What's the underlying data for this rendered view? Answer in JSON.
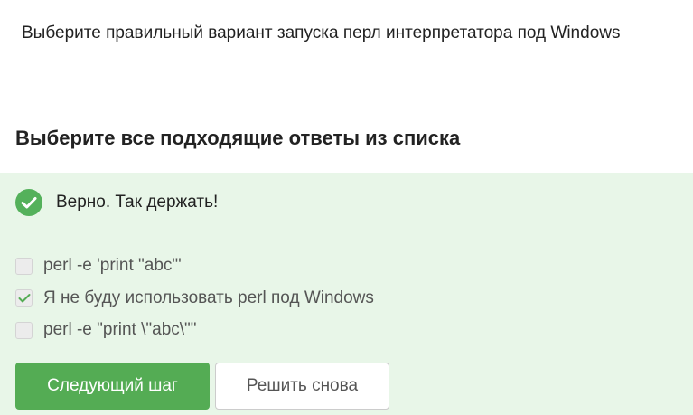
{
  "question": {
    "text": "Выберите правильный вариант запуска перл интерпретатора под Windows"
  },
  "section": {
    "title": "Выберите все подходящие ответы из списка"
  },
  "feedback": {
    "icon": "check-circle-icon",
    "text": "Верно. Так держать!",
    "color": "#54b15b"
  },
  "options": [
    {
      "label": "perl -e 'print \"abc\"'",
      "checked": false
    },
    {
      "label": "Я не буду использовать perl под Windows",
      "checked": true
    },
    {
      "label": "perl -e \"print \\\"abc\\\"\"",
      "checked": false
    }
  ],
  "buttons": {
    "next_label": "Следующий шаг",
    "retry_label": "Решить снова",
    "next_color": "#54ac54"
  }
}
